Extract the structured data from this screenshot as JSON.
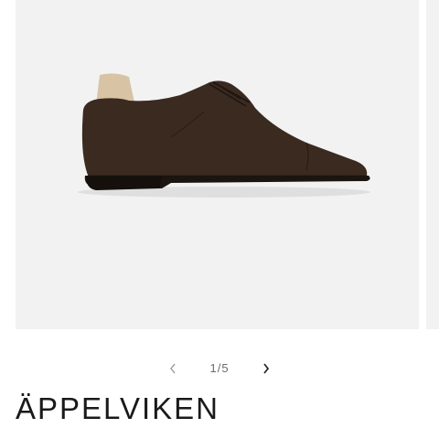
{
  "gallery": {
    "current": "1",
    "separator": "/",
    "total": "5",
    "prev_icon": "chevron-left-icon",
    "next_icon": "chevron-right-icon",
    "background_color": "#f2f2f2"
  },
  "product": {
    "title": "ÄPPELVIKEN",
    "shoe_color": "#3a2a20",
    "sole_color": "#1b1410",
    "lining_color": "#d8c3a4"
  }
}
